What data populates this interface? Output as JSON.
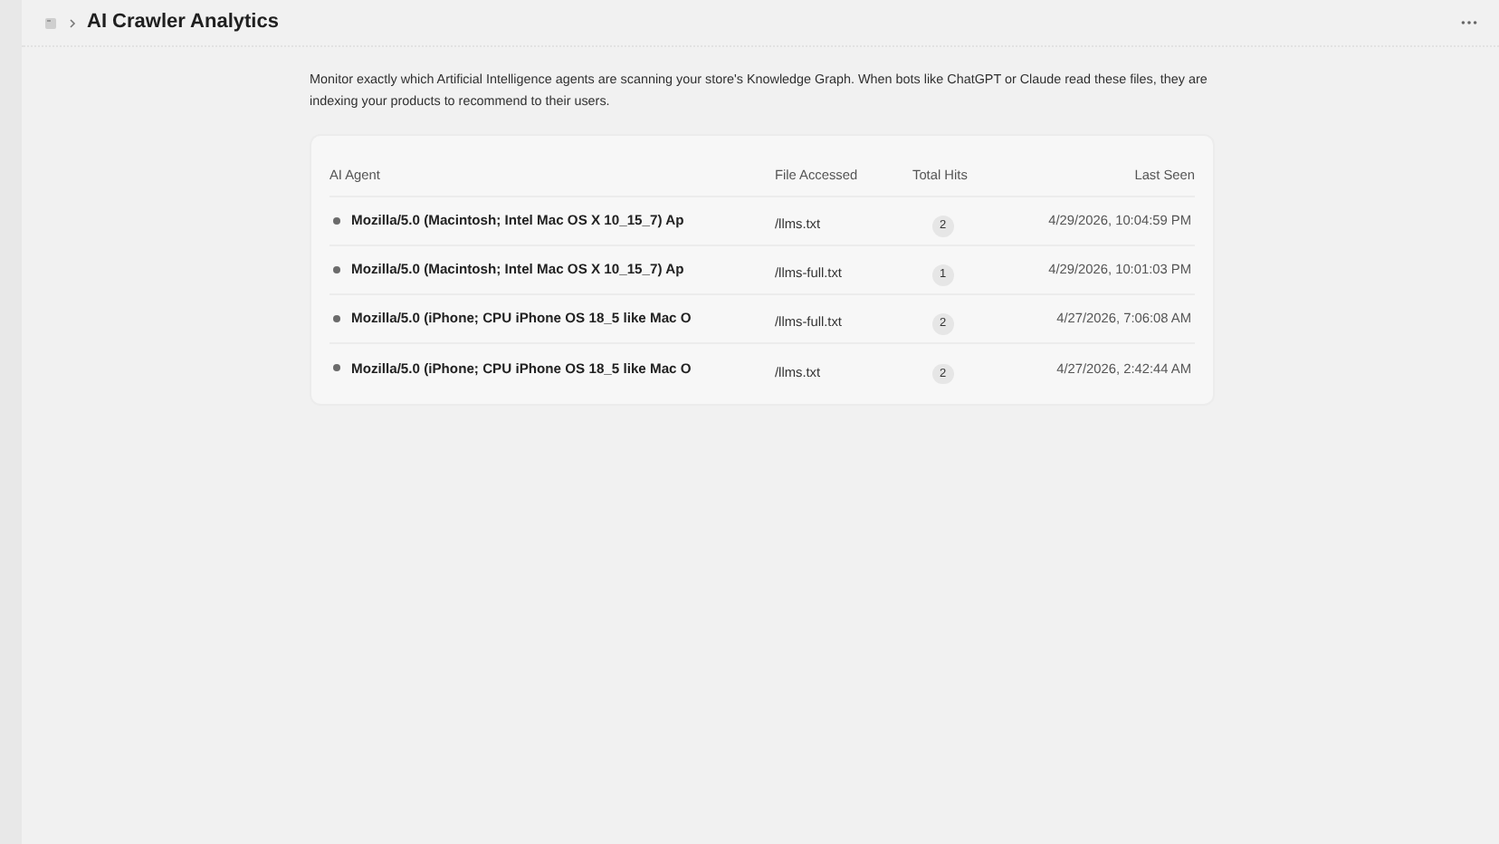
{
  "header": {
    "title": "AI Crawler Analytics"
  },
  "description": "Monitor exactly which Artificial Intelligence agents are scanning your store's Knowledge Graph. When bots like ChatGPT or Claude read these files, they are indexing your products to recommend to their users.",
  "table": {
    "columns": [
      "AI Agent",
      "File Accessed",
      "Total Hits",
      "Last Seen"
    ],
    "rows": [
      {
        "agent": "Mozilla/5.0 (Macintosh; Intel Mac OS X 10_15_7) Ap",
        "file": "/llms.txt",
        "hits": "2",
        "last_seen": "4/29/2026, 10:04:59 PM"
      },
      {
        "agent": "Mozilla/5.0 (Macintosh; Intel Mac OS X 10_15_7) Ap",
        "file": "/llms-full.txt",
        "hits": "1",
        "last_seen": "4/29/2026, 10:01:03 PM"
      },
      {
        "agent": "Mozilla/5.0 (iPhone; CPU iPhone OS 18_5 like Mac O",
        "file": "/llms-full.txt",
        "hits": "2",
        "last_seen": "4/27/2026, 7:06:08 AM"
      },
      {
        "agent": "Mozilla/5.0 (iPhone; CPU iPhone OS 18_5 like Mac O",
        "file": "/llms.txt",
        "hits": "2",
        "last_seen": "4/27/2026, 2:42:44 AM"
      }
    ]
  }
}
